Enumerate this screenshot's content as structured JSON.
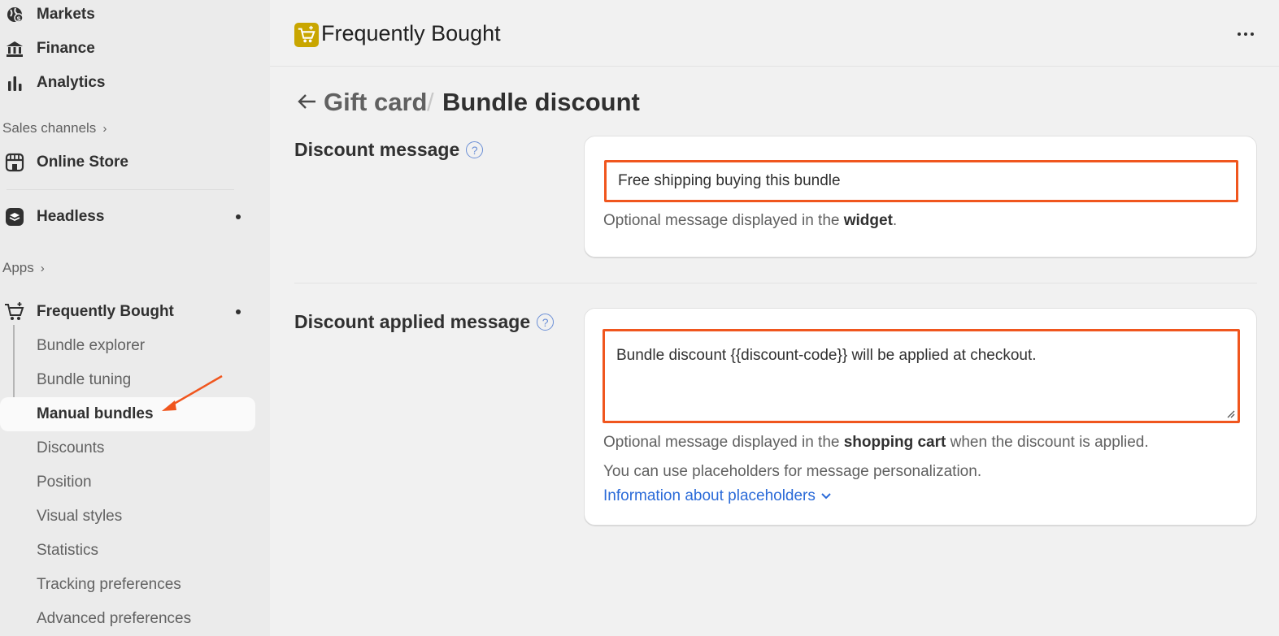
{
  "sidebar": {
    "top_items": [
      {
        "label": "Markets",
        "icon": "globe-dollar-icon"
      },
      {
        "label": "Finance",
        "icon": "bank-icon"
      },
      {
        "label": "Analytics",
        "icon": "bar-chart-icon"
      }
    ],
    "sales_channels_label": "Sales channels",
    "online_store_label": "Online Store",
    "headless_label": "Headless",
    "apps_label": "Apps",
    "app_label": "Frequently Bought",
    "app_sub_items": [
      {
        "label": "Bundle explorer"
      },
      {
        "label": "Bundle tuning"
      },
      {
        "label": "Manual bundles",
        "active": true
      },
      {
        "label": "Discounts"
      },
      {
        "label": "Position"
      },
      {
        "label": "Visual styles"
      },
      {
        "label": "Statistics"
      },
      {
        "label": "Tracking preferences"
      },
      {
        "label": "Advanced preferences"
      }
    ]
  },
  "header": {
    "app_title": "Frequently Bought",
    "logo_color": "#c9a600"
  },
  "breadcrumb": {
    "parent": "Gift card",
    "separator": "/",
    "current": "Bundle discount"
  },
  "discount_message": {
    "label": "Discount message",
    "value": "Free shipping buying this bundle",
    "helper_prefix": "Optional message displayed in the ",
    "helper_bold": "widget",
    "helper_suffix": "."
  },
  "discount_applied_message": {
    "label": "Discount applied message",
    "value": "Bundle discount {{discount-code}} will be applied at checkout.",
    "helper_prefix": "Optional message displayed in the ",
    "helper_bold": "shopping cart",
    "helper_suffix": " when the discount is applied.",
    "placeholder_note": "You can use placeholders for message personalization.",
    "placeholder_link": "Information about placeholders"
  },
  "colors": {
    "highlight": "#f0561e",
    "link": "#2a6ad8"
  }
}
